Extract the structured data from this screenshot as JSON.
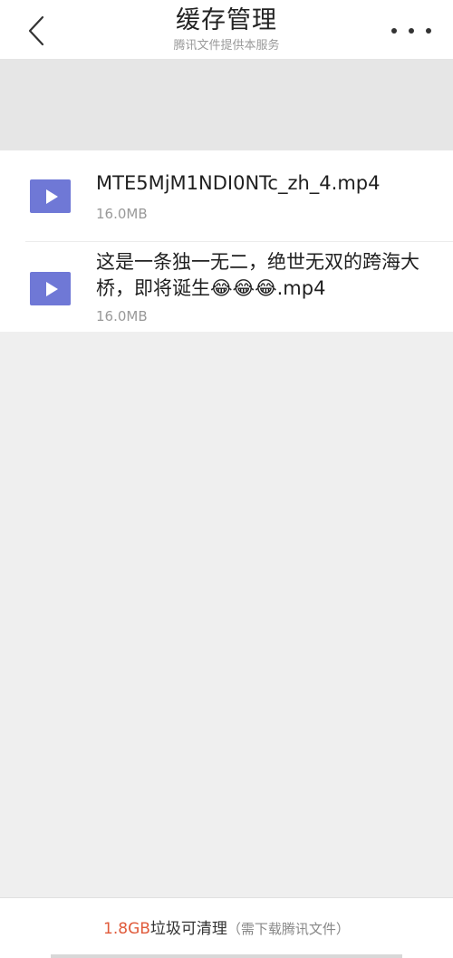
{
  "header": {
    "title": "缓存管理",
    "subtitle": "腾讯文件提供本服务",
    "back_icon": "chevron-left-icon",
    "more_icon": "more-dots-icon"
  },
  "files": [
    {
      "name": "MTE5MjM1NDI0NTc_zh_4.mp4",
      "size": "16.0MB",
      "icon": "video-play-icon"
    },
    {
      "name": "这是一条独一无二，绝世无双的跨海大桥，即将诞生😂😂😂.mp4",
      "size": "16.0MB",
      "icon": "video-play-icon"
    }
  ],
  "footer": {
    "size": "1.8GB",
    "label": "垃圾可清理",
    "note": "（需下载腾讯文件）"
  },
  "colors": {
    "accent_thumb": "#6f78d6",
    "footer_size": "#e05a3a",
    "background": "#efefef"
  }
}
